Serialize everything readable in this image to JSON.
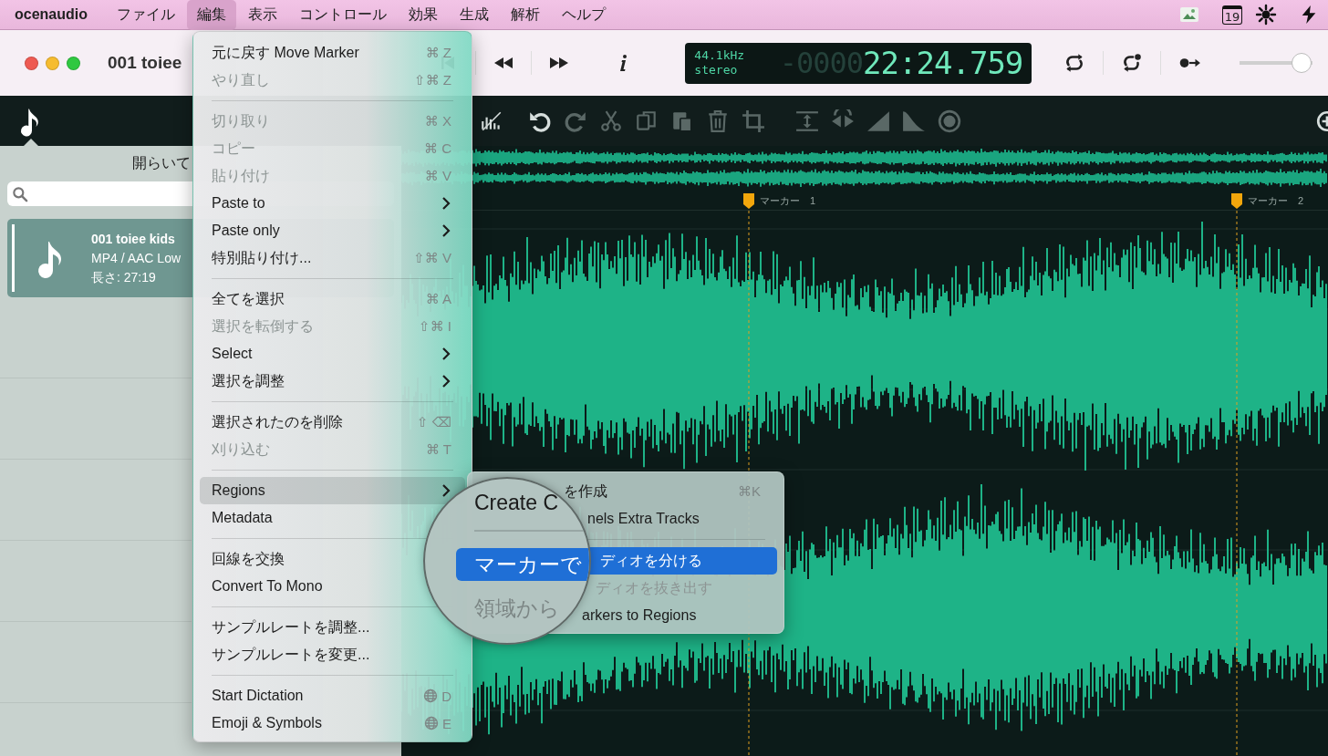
{
  "menubar": {
    "app_name": "ocenaudio",
    "menus": [
      {
        "label": "ファイル",
        "selected": false
      },
      {
        "label": "編集",
        "selected": true
      },
      {
        "label": "表示",
        "selected": false
      },
      {
        "label": "コントロール",
        "selected": false
      },
      {
        "label": "効果",
        "selected": false
      },
      {
        "label": "生成",
        "selected": false
      },
      {
        "label": "解析",
        "selected": false
      },
      {
        "label": "ヘルプ",
        "selected": false
      }
    ],
    "calendar_day": "19"
  },
  "window": {
    "title": "001 toiee",
    "transport": [
      {
        "kind": "skip-back"
      },
      {
        "kind": "rewind"
      },
      {
        "kind": "forward"
      },
      {
        "kind": "info"
      }
    ],
    "display": {
      "sample_rate": "44.1kHz",
      "channels": "stereo",
      "time_dim": "-0000",
      "time": "22:24.759"
    },
    "playback_modes": [
      {
        "kind": "loop"
      },
      {
        "kind": "loop-one"
      },
      {
        "kind": "follow"
      }
    ],
    "volume": {
      "level": 0.98
    }
  },
  "sidebar": {
    "heading": "開らいて",
    "files": [
      {
        "title": "001 toiee kids",
        "format": "MP4 / AAC Low",
        "duration": "長さ: 27:19",
        "selected": true
      }
    ]
  },
  "toolbar": {
    "tools": [
      {
        "kind": "spectrum",
        "disabled": false
      },
      {
        "kind": "undo",
        "disabled": false
      },
      {
        "kind": "redo",
        "disabled": true
      },
      {
        "kind": "cut",
        "disabled": true
      },
      {
        "kind": "copy",
        "disabled": true
      },
      {
        "kind": "paste",
        "disabled": true
      },
      {
        "kind": "trash",
        "disabled": true
      },
      {
        "kind": "crop",
        "disabled": true
      },
      {
        "kind": "fit",
        "disabled": true
      },
      {
        "kind": "reverse",
        "disabled": true
      },
      {
        "kind": "fade-in",
        "disabled": true
      },
      {
        "kind": "fade-out",
        "disabled": true
      },
      {
        "kind": "knob",
        "disabled": true
      },
      {
        "kind": "zoom",
        "disabled": false
      }
    ]
  },
  "markers": [
    {
      "label": "マーカー　1"
    },
    {
      "label": "マーカー　2"
    }
  ],
  "edit_menu": {
    "items": [
      {
        "kind": "item",
        "label": "元に戻す Move Marker",
        "shortcut": "⌘ Z",
        "disabled": false,
        "selected": false
      },
      {
        "kind": "item",
        "label": "やり直し",
        "shortcut": "⇧⌘ Z",
        "disabled": true,
        "selected": false
      },
      {
        "kind": "separator"
      },
      {
        "kind": "item",
        "label": "切り取り",
        "shortcut": "⌘ X",
        "disabled": true,
        "selected": false
      },
      {
        "kind": "item",
        "label": "コピー",
        "shortcut": "⌘ C",
        "disabled": true,
        "selected": false
      },
      {
        "kind": "item",
        "label": "貼り付け",
        "shortcut": "⌘ V",
        "disabled": true,
        "selected": false
      },
      {
        "kind": "submenu",
        "label": "Paste to",
        "disabled": false,
        "selected": false
      },
      {
        "kind": "submenu",
        "label": "Paste only",
        "disabled": false,
        "selected": false
      },
      {
        "kind": "item",
        "label": "特別貼り付け...",
        "shortcut": "⇧⌘ V",
        "disabled": false,
        "selected": false
      },
      {
        "kind": "separator"
      },
      {
        "kind": "item",
        "label": "全てを選択",
        "shortcut": "⌘ A",
        "disabled": false,
        "selected": false
      },
      {
        "kind": "item",
        "label": "選択を転倒する",
        "shortcut": "⇧⌘ I",
        "disabled": true,
        "selected": false
      },
      {
        "kind": "submenu",
        "label": "Select",
        "disabled": false,
        "selected": false
      },
      {
        "kind": "submenu",
        "label": "選択を調整",
        "disabled": false,
        "selected": false
      },
      {
        "kind": "separator"
      },
      {
        "kind": "item",
        "label": "選択されたのを削除",
        "shortcut": "⇧ ⌫",
        "disabled": false,
        "selected": false
      },
      {
        "kind": "item",
        "label": "刈り込む",
        "shortcut": "⌘ T",
        "disabled": true,
        "selected": false
      },
      {
        "kind": "separator"
      },
      {
        "kind": "submenu",
        "label": "Regions",
        "disabled": false,
        "selected": true
      },
      {
        "kind": "item",
        "label": "Metadata",
        "disabled": false,
        "selected": false
      },
      {
        "kind": "separator"
      },
      {
        "kind": "item",
        "label": "回線を交換",
        "disabled": false,
        "selected": false
      },
      {
        "kind": "item",
        "label": "Convert To Mono",
        "disabled": false,
        "selected": false
      },
      {
        "kind": "separator"
      },
      {
        "kind": "item",
        "label": "サンプルレートを調整...",
        "disabled": false,
        "selected": false
      },
      {
        "kind": "item",
        "label": "サンプルレートを変更...",
        "disabled": false,
        "selected": false
      },
      {
        "kind": "separator"
      },
      {
        "kind": "globe",
        "label": "Start Dictation",
        "shortcut": "D",
        "disabled": false,
        "selected": false
      },
      {
        "kind": "globe",
        "label": "Emoji & Symbols",
        "shortcut": "E",
        "disabled": false,
        "selected": false
      }
    ]
  },
  "regions_submenu": {
    "items": [
      {
        "kind": "item",
        "label": "を作成",
        "shortcut": "⌘K",
        "disabled": false,
        "selected": false
      },
      {
        "kind": "item",
        "label": "nels Extra Tracks",
        "disabled": false,
        "selected": false
      },
      {
        "kind": "separator"
      },
      {
        "kind": "item",
        "label": "ディオを分ける",
        "disabled": false,
        "selected": true
      },
      {
        "kind": "item",
        "label": "ディオを抜き出す",
        "disabled": true,
        "selected": false
      },
      {
        "kind": "item",
        "label": "arkers to Regions",
        "disabled": false,
        "selected": false
      }
    ]
  },
  "magnifier": {
    "lines": [
      {
        "kind": "item",
        "label": "Create C",
        "selected": false,
        "disabled": false
      },
      {
        "kind": "separator"
      },
      {
        "kind": "item",
        "label": "マーカーで",
        "selected": true,
        "disabled": false
      },
      {
        "kind": "item",
        "label": "領域から",
        "selected": false,
        "disabled": true
      }
    ]
  }
}
